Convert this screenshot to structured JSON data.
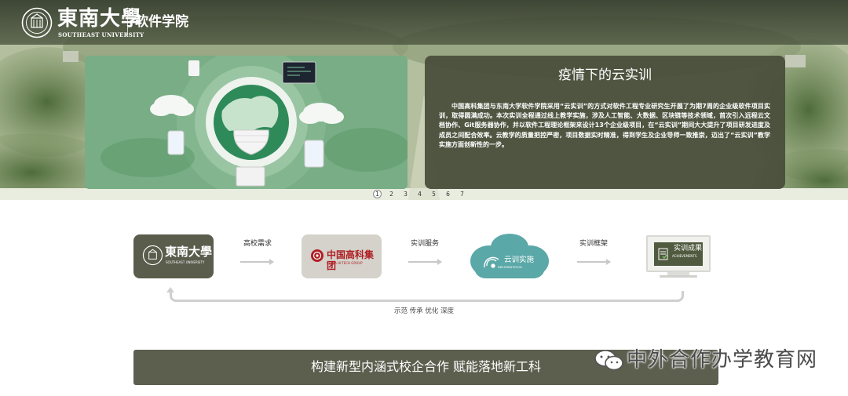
{
  "header": {
    "university_name": "東南大學",
    "university_en": "SOUTHEAST UNIVERSITY",
    "school_name": "软件学院"
  },
  "slide": {
    "title": "疫情下的云实训",
    "body": "中国高科集团与东南大学软件学院采用“云实训”的方式对软件工程专业研究生开展了为期7周的企业级软件项目实训，取得圆满成功。本次实训全程通过线上教学实施，涉及人工智能、大数据、区块链等技术领域，首次引入远程云文档协作、Git服务器协作，并以软件工程理论框架来设计13个企业级项目，在“云实训”期间大大提升了项目研发进度及成员之间配合效率。云教学的质量把控严密，项目数据实时精准，得到学生及企业导师一致推崇，迈出了“云实训”教学实施方面创新性的一步。",
    "pages": [
      "1",
      "2",
      "3",
      "4",
      "5",
      "6",
      "7"
    ],
    "active_page": 1
  },
  "flow": {
    "seu_logo_text": "東南大學",
    "seu_logo_en": "SOUTHEAST UNIVERSITY",
    "label_demand": "高校需求",
    "cc_logo_text": "中国高科集团",
    "cc_logo_en": "CHINA HI-TECH GROUP",
    "label_service": "实训服务",
    "cloud_label": "云训实施",
    "cloud_sub": "IMPLEMENTATION",
    "label_framework": "实训框架",
    "result_label": "实训成果",
    "result_sub": "ACHIEVEMENTS",
    "return_label": "示范 传承 优化 深度"
  },
  "banner": {
    "text": "构建新型内涵式校企合作 赋能落地新工科"
  },
  "watermark": {
    "text": "中外合作办学教育网"
  },
  "colors": {
    "panel": "#484c3a",
    "node_dark": "#5a5c4c",
    "cloud": "#5aa7a7",
    "accent_red": "#b01e24"
  }
}
